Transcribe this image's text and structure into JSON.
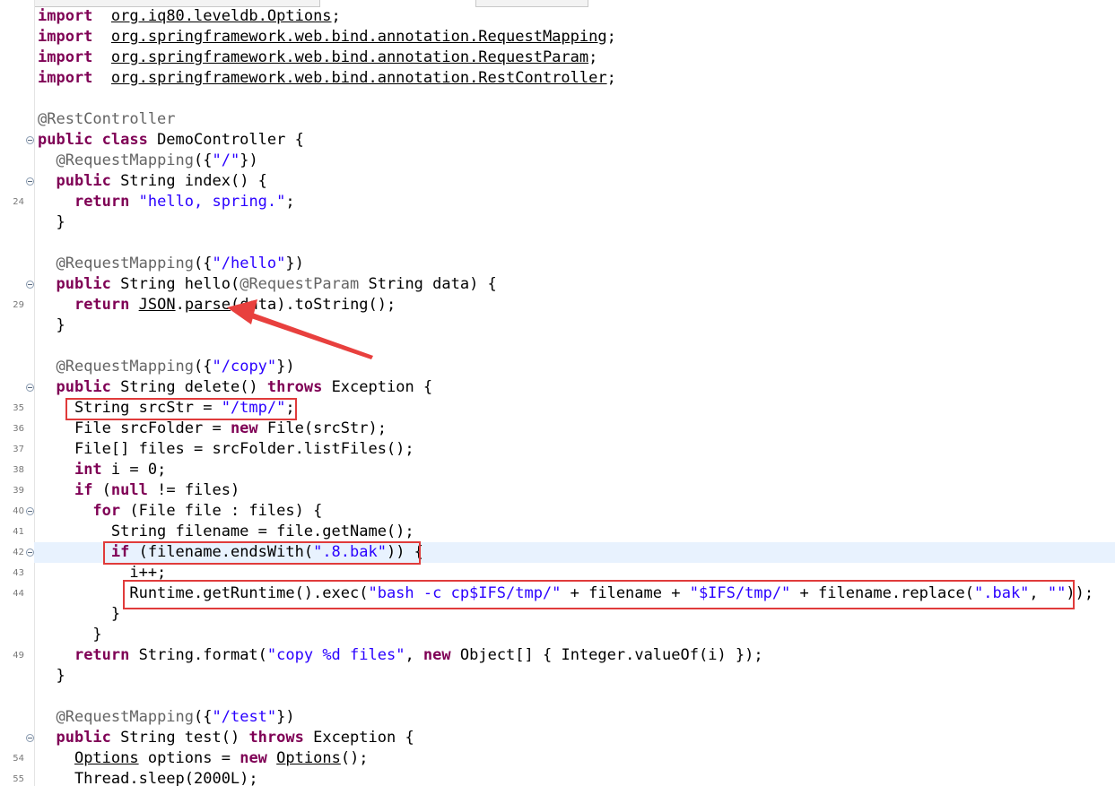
{
  "editor": {
    "lines": [
      {
        "num": "",
        "segs": [
          [
            "kw",
            "import"
          ],
          [
            "",
            "  "
          ],
          [
            "ul",
            "org.iq80.leveldb.Options"
          ],
          [
            "",
            ";"
          ]
        ]
      },
      {
        "num": "",
        "segs": [
          [
            "kw",
            "import"
          ],
          [
            "",
            "  "
          ],
          [
            "ul",
            "org.springframework.web.bind.annotation.RequestMapping"
          ],
          [
            "",
            ";"
          ]
        ]
      },
      {
        "num": "",
        "segs": [
          [
            "kw",
            "import"
          ],
          [
            "",
            "  "
          ],
          [
            "ul",
            "org.springframework.web.bind.annotation.RequestParam"
          ],
          [
            "",
            ";"
          ]
        ]
      },
      {
        "num": "",
        "segs": [
          [
            "kw",
            "import"
          ],
          [
            "",
            "  "
          ],
          [
            "ul",
            "org.springframework.web.bind.annotation.RestController"
          ],
          [
            "",
            ";"
          ]
        ]
      },
      {
        "num": "",
        "segs": []
      },
      {
        "num": "",
        "segs": [
          [
            "ann",
            "@RestController"
          ]
        ]
      },
      {
        "num": "",
        "fold": true,
        "segs": [
          [
            "kw",
            "public class"
          ],
          [
            "",
            " DemoController {"
          ]
        ]
      },
      {
        "num": "",
        "segs": [
          [
            "",
            "  "
          ],
          [
            "ann",
            "@RequestMapping"
          ],
          [
            "",
            "({"
          ],
          [
            "str",
            "\"/\""
          ],
          [
            "",
            "})"
          ]
        ]
      },
      {
        "num": "",
        "fold": true,
        "segs": [
          [
            "",
            "  "
          ],
          [
            "kw",
            "public"
          ],
          [
            "",
            " String index() {"
          ]
        ]
      },
      {
        "num": "24",
        "segs": [
          [
            "",
            "    "
          ],
          [
            "kw",
            "return"
          ],
          [
            "",
            " "
          ],
          [
            "str",
            "\"hello, spring.\""
          ],
          [
            "",
            ";"
          ]
        ]
      },
      {
        "num": "",
        "segs": [
          [
            "",
            "  }"
          ]
        ]
      },
      {
        "num": "",
        "segs": []
      },
      {
        "num": "",
        "segs": [
          [
            "",
            "  "
          ],
          [
            "ann",
            "@RequestMapping"
          ],
          [
            "",
            "({"
          ],
          [
            "str",
            "\"/hello\""
          ],
          [
            "",
            "})"
          ]
        ]
      },
      {
        "num": "",
        "fold": true,
        "segs": [
          [
            "",
            "  "
          ],
          [
            "kw",
            "public"
          ],
          [
            "",
            " String hello("
          ],
          [
            "ann",
            "@RequestParam"
          ],
          [
            "",
            " String data) {"
          ]
        ]
      },
      {
        "num": "29",
        "segs": [
          [
            "",
            "    "
          ],
          [
            "kw",
            "return"
          ],
          [
            "",
            " "
          ],
          [
            "ul",
            "JSON"
          ],
          [
            "",
            "."
          ],
          [
            "ul",
            "parse"
          ],
          [
            "",
            "(data).toString();"
          ]
        ]
      },
      {
        "num": "",
        "segs": [
          [
            "",
            "  }"
          ]
        ]
      },
      {
        "num": "",
        "segs": []
      },
      {
        "num": "",
        "segs": [
          [
            "",
            "  "
          ],
          [
            "ann",
            "@RequestMapping"
          ],
          [
            "",
            "({"
          ],
          [
            "str",
            "\"/copy\""
          ],
          [
            "",
            "})"
          ]
        ]
      },
      {
        "num": "",
        "fold": true,
        "segs": [
          [
            "",
            "  "
          ],
          [
            "kw",
            "public"
          ],
          [
            "",
            " String delete() "
          ],
          [
            "kw",
            "throws"
          ],
          [
            "",
            " Exception {"
          ]
        ]
      },
      {
        "num": "35",
        "segs": [
          [
            "",
            "    String srcStr = "
          ],
          [
            "str",
            "\"/tmp/\""
          ],
          [
            "",
            ";"
          ]
        ]
      },
      {
        "num": "36",
        "segs": [
          [
            "",
            "    File srcFolder = "
          ],
          [
            "kw",
            "new"
          ],
          [
            "",
            " File(srcStr);"
          ]
        ]
      },
      {
        "num": "37",
        "segs": [
          [
            "",
            "    File[] files = srcFolder.listFiles();"
          ]
        ]
      },
      {
        "num": "38",
        "segs": [
          [
            "",
            "    "
          ],
          [
            "kw",
            "int"
          ],
          [
            "",
            " i = 0;"
          ]
        ]
      },
      {
        "num": "39",
        "segs": [
          [
            "",
            "    "
          ],
          [
            "kw",
            "if"
          ],
          [
            "",
            " ("
          ],
          [
            "kw",
            "null"
          ],
          [
            "",
            " != files)"
          ]
        ]
      },
      {
        "num": "40",
        "fold": true,
        "segs": [
          [
            "",
            "      "
          ],
          [
            "kw",
            "for"
          ],
          [
            "",
            " (File file : files) {"
          ]
        ]
      },
      {
        "num": "41",
        "segs": [
          [
            "",
            "        String filename = file.getName();"
          ]
        ]
      },
      {
        "num": "42",
        "fold": true,
        "current": true,
        "segs": [
          [
            "",
            "        "
          ],
          [
            "kw",
            "if"
          ],
          [
            "",
            " (filename.endsWith("
          ],
          [
            "str",
            "\".8.bak\""
          ],
          [
            "",
            ")) {"
          ]
        ]
      },
      {
        "num": "43",
        "segs": [
          [
            "",
            "          i++;"
          ]
        ]
      },
      {
        "num": "44",
        "segs": [
          [
            "",
            "          Runtime.getRuntime().exec("
          ],
          [
            "str",
            "\"bash -c cp$IFS/tmp/\""
          ],
          [
            "",
            " + filename + "
          ],
          [
            "str",
            "\"$IFS/tmp/\""
          ],
          [
            "",
            " + filename.replace("
          ],
          [
            "str",
            "\".bak\""
          ],
          [
            "",
            ", "
          ],
          [
            "str",
            "\"\""
          ],
          [
            "",
            "));"
          ]
        ]
      },
      {
        "num": "",
        "segs": [
          [
            "",
            "        }"
          ]
        ]
      },
      {
        "num": "",
        "segs": [
          [
            "",
            "      }"
          ]
        ]
      },
      {
        "num": "49",
        "segs": [
          [
            "",
            "    "
          ],
          [
            "kw",
            "return"
          ],
          [
            "",
            " String.format("
          ],
          [
            "str",
            "\"copy %d files\""
          ],
          [
            "",
            ", "
          ],
          [
            "kw",
            "new"
          ],
          [
            "",
            " Object[] { Integer.valueOf(i) });"
          ]
        ]
      },
      {
        "num": "",
        "segs": [
          [
            "",
            "  }"
          ]
        ]
      },
      {
        "num": "",
        "segs": []
      },
      {
        "num": "",
        "segs": [
          [
            "",
            "  "
          ],
          [
            "ann",
            "@RequestMapping"
          ],
          [
            "",
            "({"
          ],
          [
            "str",
            "\"/test\""
          ],
          [
            "",
            "})"
          ]
        ]
      },
      {
        "num": "",
        "fold": true,
        "segs": [
          [
            "",
            "  "
          ],
          [
            "kw",
            "public"
          ],
          [
            "",
            " String test() "
          ],
          [
            "kw",
            "throws"
          ],
          [
            "",
            " Exception {"
          ]
        ]
      },
      {
        "num": "54",
        "segs": [
          [
            "",
            "    "
          ],
          [
            "ul",
            "Options"
          ],
          [
            "",
            " options = "
          ],
          [
            "kw",
            "new"
          ],
          [
            "",
            " "
          ],
          [
            "ul",
            "Options"
          ],
          [
            "",
            "();"
          ]
        ]
      },
      {
        "num": "55",
        "segs": [
          [
            "",
            "    Thread.sleep(2000L);"
          ]
        ]
      }
    ]
  },
  "annotations": {
    "box_color": "#e03b3b",
    "arrow_color": "#e8403e"
  }
}
